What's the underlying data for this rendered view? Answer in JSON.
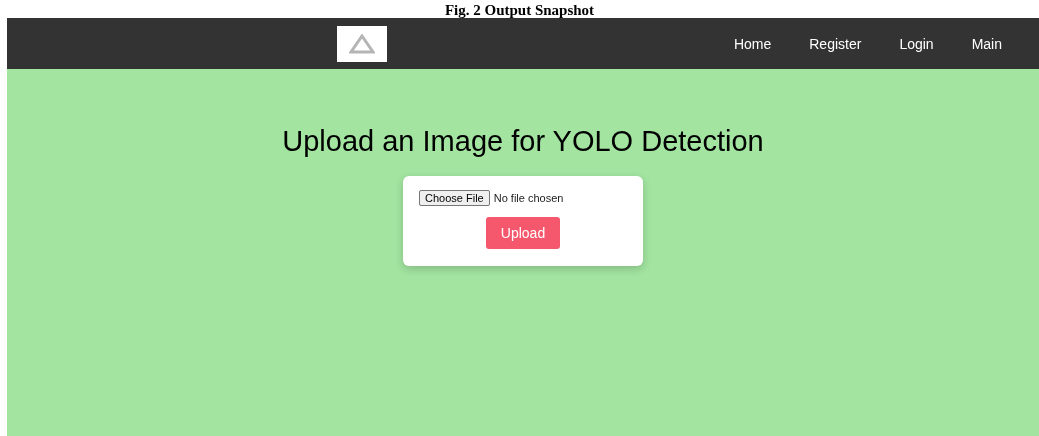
{
  "caption": "Fig. 2 Output Snapshot",
  "navbar": {
    "links": [
      {
        "label": "Home"
      },
      {
        "label": "Register"
      },
      {
        "label": "Login"
      },
      {
        "label": "Main"
      }
    ]
  },
  "heading": "Upload an Image for YOLO Detection",
  "upload_form": {
    "choose_button": "Choose File",
    "file_status": "No file chosen",
    "submit": "Upload"
  }
}
